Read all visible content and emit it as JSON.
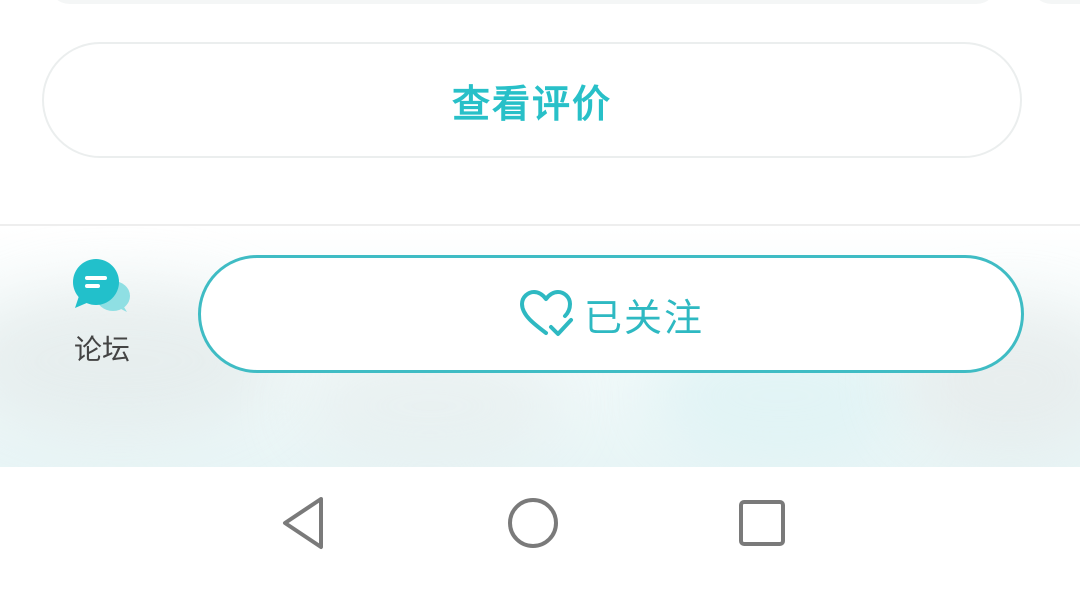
{
  "content": {
    "view_reviews_label": "查看评价"
  },
  "bottom_bar": {
    "forum_label": "论坛",
    "follow_label": "已关注"
  },
  "icons": {
    "forum": "chat-bubble-icon",
    "follow": "heart-check-icon",
    "back": "triangle-back-icon",
    "home": "circle-home-icon",
    "recents": "square-recents-icon"
  },
  "colors": {
    "accent": "#28c0c8",
    "follow_border": "#3fbcc4",
    "nav_gray": "#7a7a7a"
  }
}
